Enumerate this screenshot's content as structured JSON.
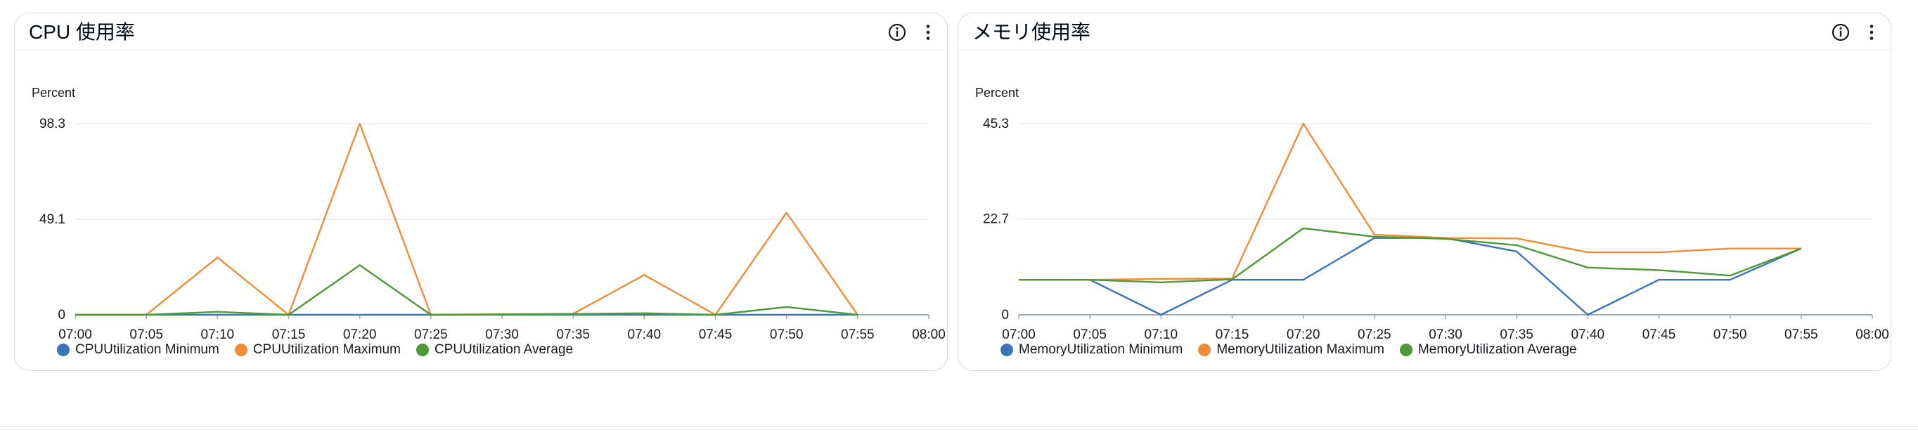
{
  "colors": {
    "minimum": "#3a75bb",
    "maximum": "#f08c36",
    "average": "#4c9b36",
    "grid": "#e9ebed",
    "axis": "#9ba7b6"
  },
  "panels": [
    {
      "title": "CPU 使用率",
      "info_icon": "info-icon",
      "menu_icon": "kebab-menu-icon",
      "legend": [
        "CPUUtilization Minimum",
        "CPUUtilization Maximum",
        "CPUUtilization Average"
      ]
    },
    {
      "title": "メモリ使用率",
      "info_icon": "info-icon",
      "menu_icon": "kebab-menu-icon",
      "legend": [
        "MemoryUtilization Minimum",
        "MemoryUtilization Maximum",
        "MemoryUtilization Average"
      ]
    }
  ],
  "chart_data": [
    {
      "type": "line",
      "ylabel": "Percent",
      "yticks": [
        0,
        49.1,
        98.3
      ],
      "ytick_labels": [
        "0",
        "49.1",
        "98.3"
      ],
      "ylim": [
        0,
        98.3
      ],
      "xtick_labels": [
        "07:00",
        "07:05",
        "07:10",
        "07:15",
        "07:20",
        "07:25",
        "07:30",
        "07:35",
        "07:40",
        "07:45",
        "07:50",
        "07:55",
        "08:00"
      ],
      "xlim": [
        0,
        60
      ],
      "legend_position": "bottom-left",
      "grid": true,
      "series": [
        {
          "name": "CPUUtilization Minimum",
          "x": [
            0,
            5,
            10,
            15,
            20,
            25,
            30,
            35,
            40,
            45,
            50,
            55
          ],
          "y": [
            0,
            0,
            0,
            0,
            0,
            0,
            0,
            0,
            0,
            0,
            0,
            0
          ]
        },
        {
          "name": "CPUUtilization Maximum",
          "x": [
            0,
            5,
            10,
            15,
            20,
            25,
            30,
            35,
            40,
            45,
            50,
            55
          ],
          "y": [
            0,
            0,
            29.5,
            0,
            98.3,
            0,
            0.3,
            0.5,
            20.5,
            0,
            52.5,
            0
          ]
        },
        {
          "name": "CPUUtilization Average",
          "x": [
            0,
            5,
            10,
            15,
            20,
            25,
            30,
            35,
            40,
            45,
            50,
            55
          ],
          "y": [
            0,
            0,
            1.5,
            0,
            25.5,
            0,
            0.2,
            0.4,
            0.8,
            0,
            4,
            0
          ]
        }
      ]
    },
    {
      "type": "line",
      "ylabel": "Percent",
      "yticks": [
        0,
        22.7,
        45.3
      ],
      "ytick_labels": [
        "0",
        "22.7",
        "45.3"
      ],
      "ylim": [
        0,
        45.3
      ],
      "xtick_labels": [
        "07:00",
        "07:05",
        "07:10",
        "07:15",
        "07:20",
        "07:25",
        "07:30",
        "07:35",
        "07:40",
        "07:45",
        "07:50",
        "07:55",
        "08:00"
      ],
      "xlim": [
        0,
        60
      ],
      "legend_position": "bottom-left",
      "grid": true,
      "series": [
        {
          "name": "MemoryUtilization Minimum",
          "x": [
            0,
            5,
            10,
            15,
            20,
            25,
            30,
            35,
            40,
            45,
            50,
            55
          ],
          "y": [
            8.3,
            8.3,
            0,
            8.3,
            8.3,
            18.2,
            18.2,
            15,
            0,
            8.3,
            8.3,
            15.7
          ]
        },
        {
          "name": "MemoryUtilization Maximum",
          "x": [
            0,
            5,
            10,
            15,
            20,
            25,
            30,
            35,
            40,
            45,
            50,
            55
          ],
          "y": [
            8.3,
            8.3,
            8.5,
            8.6,
            45.3,
            19,
            18.2,
            18.1,
            14.8,
            14.8,
            15.7,
            15.7
          ]
        },
        {
          "name": "MemoryUtilization Average",
          "x": [
            0,
            5,
            10,
            15,
            20,
            25,
            30,
            35,
            40,
            45,
            50,
            55
          ],
          "y": [
            8.3,
            8.3,
            7.7,
            8.4,
            20.5,
            18.5,
            18,
            16.5,
            11.2,
            10.6,
            9.3,
            15.7
          ]
        }
      ]
    }
  ]
}
